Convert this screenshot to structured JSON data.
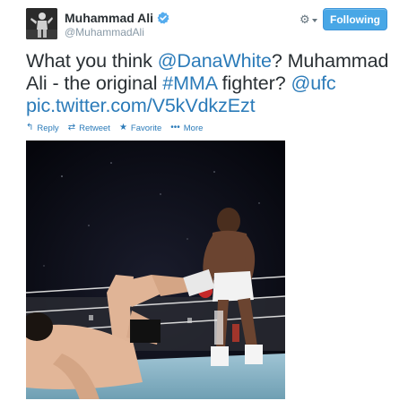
{
  "user": {
    "fullname": "Muhammad Ali",
    "handle": "@MuhammadAli"
  },
  "header": {
    "follow_label": "Following"
  },
  "tweet": {
    "parts": [
      {
        "text": "What you think ",
        "link": false
      },
      {
        "text": "@DanaWhite",
        "link": true
      },
      {
        "text": "? Muhammad Ali - the original ",
        "link": false
      },
      {
        "text": "#MMA",
        "link": true
      },
      {
        "text": " fighter? ",
        "link": false
      },
      {
        "text": "@ufc",
        "link": true
      },
      {
        "text": " ",
        "link": false
      },
      {
        "text": "pic.twitter.com/V5kVdkzEzt",
        "link": true
      }
    ]
  },
  "actions": {
    "reply": "Reply",
    "retweet": "Retweet",
    "favorite": "Favorite",
    "more": "More"
  },
  "colors": {
    "link": "#2b7bb9",
    "follow_button": "#48a7e6",
    "verified": "#55acee"
  },
  "icons": {
    "reply": "reply-arrow-icon",
    "retweet": "retweet-icon",
    "favorite": "star-icon",
    "more": "ellipsis-icon",
    "gear": "gear-icon"
  }
}
